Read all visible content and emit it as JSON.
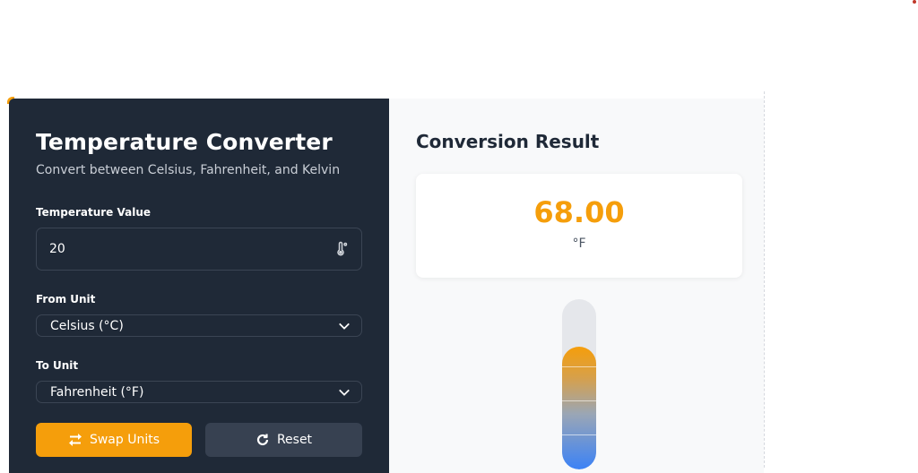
{
  "converter": {
    "title": "Temperature Converter",
    "subtitle": "Convert between Celsius, Fahrenheit, and Kelvin",
    "temperature_label": "Temperature Value",
    "temperature_value": "20",
    "temperature_icon": "thermometer-icon",
    "from_label": "From Unit",
    "from_value": "Celsius (°C)",
    "to_label": "To Unit",
    "to_value": "Fahrenheit (°F)",
    "swap_label": "Swap Units",
    "reset_label": "Reset"
  },
  "result": {
    "title": "Conversion Result",
    "value": "68.00",
    "unit": "°F",
    "thermometer_level": 0.72
  },
  "colors": {
    "accent": "#f59e0b",
    "panel_dark": "#1f2937",
    "panel_light": "#f8f9fa",
    "cold": "#3b82f6"
  }
}
